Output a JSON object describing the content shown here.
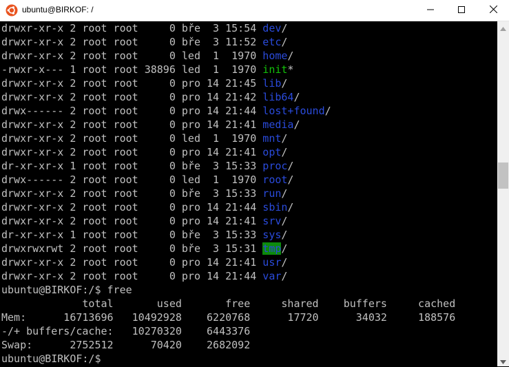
{
  "window": {
    "title": "ubuntu@BIRKOF: /"
  },
  "icons": {
    "app": "ubuntu-logo-icon",
    "minimize": "minimize-icon",
    "maximize": "maximize-icon",
    "close": "close-icon",
    "scroll_up": "arrow-up-icon",
    "scroll_down": "arrow-down-icon"
  },
  "colors": {
    "directory": "#2a4bdc",
    "executable": "#13c20a",
    "sticky_dir_bg": "#0c8a0c",
    "text": "#c0c0c0",
    "ubuntu_orange": "#e95420"
  },
  "listing": [
    {
      "meta": "drwxr-xr-x 2 root root     0 bře  3 15:54 ",
      "name": "dev",
      "suffix": "/",
      "type": "dir"
    },
    {
      "meta": "drwxr-xr-x 2 root root     0 bře  3 11:52 ",
      "name": "etc",
      "suffix": "/",
      "type": "dir"
    },
    {
      "meta": "drwxr-xr-x 2 root root     0 led  1  1970 ",
      "name": "home",
      "suffix": "/",
      "type": "dir"
    },
    {
      "meta": "-rwxr-x--- 1 root root 38896 led  1  1970 ",
      "name": "init",
      "suffix": "*",
      "type": "exe"
    },
    {
      "meta": "drwxr-xr-x 2 root root     0 pro 14 21:45 ",
      "name": "lib",
      "suffix": "/",
      "type": "dir"
    },
    {
      "meta": "drwxr-xr-x 2 root root     0 pro 14 21:42 ",
      "name": "lib64",
      "suffix": "/",
      "type": "dir"
    },
    {
      "meta": "drwx------ 2 root root     0 pro 14 21:44 ",
      "name": "lost+found",
      "suffix": "/",
      "type": "dir"
    },
    {
      "meta": "drwxr-xr-x 2 root root     0 pro 14 21:41 ",
      "name": "media",
      "suffix": "/",
      "type": "dir"
    },
    {
      "meta": "drwxr-xr-x 2 root root     0 led  1  1970 ",
      "name": "mnt",
      "suffix": "/",
      "type": "dir"
    },
    {
      "meta": "drwxr-xr-x 2 root root     0 pro 14 21:41 ",
      "name": "opt",
      "suffix": "/",
      "type": "dir"
    },
    {
      "meta": "dr-xr-xr-x 1 root root     0 bře  3 15:33 ",
      "name": "proc",
      "suffix": "/",
      "type": "dir"
    },
    {
      "meta": "drwx------ 2 root root     0 led  1  1970 ",
      "name": "root",
      "suffix": "/",
      "type": "dir"
    },
    {
      "meta": "drwxr-xr-x 2 root root     0 bře  3 15:33 ",
      "name": "run",
      "suffix": "/",
      "type": "dir"
    },
    {
      "meta": "drwxr-xr-x 2 root root     0 pro 14 21:44 ",
      "name": "sbin",
      "suffix": "/",
      "type": "dir"
    },
    {
      "meta": "drwxr-xr-x 2 root root     0 pro 14 21:41 ",
      "name": "srv",
      "suffix": "/",
      "type": "dir"
    },
    {
      "meta": "dr-xr-xr-x 1 root root     0 bře  3 15:33 ",
      "name": "sys",
      "suffix": "/",
      "type": "dir"
    },
    {
      "meta": "drwxrwxrwt 2 root root     0 bře  3 15:31 ",
      "name": "tmp",
      "suffix": "/",
      "type": "tmp"
    },
    {
      "meta": "drwxr-xr-x 2 root root     0 pro 14 21:41 ",
      "name": "usr",
      "suffix": "/",
      "type": "dir"
    },
    {
      "meta": "drwxr-xr-x 2 root root     0 pro 14 21:44 ",
      "name": "var",
      "suffix": "/",
      "type": "dir"
    }
  ],
  "command": "ubuntu@BIRKOF:/$ free",
  "free_output": [
    "             total       used       free     shared    buffers     cached",
    "Mem:      16713696   10492928    6220768      17720      34032     188576",
    "-/+ buffers/cache:   10270320    6443376",
    "Swap:      2752512      70420    2682092"
  ],
  "prompt": "ubuntu@BIRKOF:/$ "
}
